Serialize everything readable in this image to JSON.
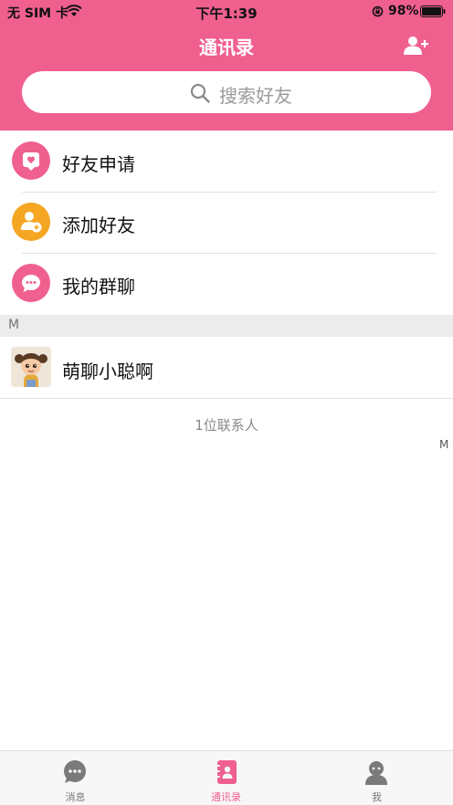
{
  "status_bar": {
    "carrier": "无 SIM 卡",
    "time": "下午1:39",
    "battery": "98%",
    "icons": [
      "wifi-icon",
      "orientation-lock-icon",
      "battery-icon"
    ]
  },
  "nav": {
    "title": "通讯录",
    "add_icon": "add-contact-icon"
  },
  "search": {
    "placeholder": "搜索好友",
    "icon": "search-icon"
  },
  "menu": [
    {
      "label": "好友申请",
      "icon": "heart-chat-icon",
      "color": "#f0608e"
    },
    {
      "label": "添加好友",
      "icon": "add-user-icon",
      "color": "#f5a623"
    },
    {
      "label": "我的群聊",
      "icon": "group-chat-icon",
      "color": "#f0608e"
    }
  ],
  "section": {
    "letter": "M"
  },
  "contacts": [
    {
      "name": "萌聊小聪啊",
      "avatar": "cartoon-girl-avatar"
    }
  ],
  "contact_count": "1位联系人",
  "index_bar": [
    "M"
  ],
  "tabs": [
    {
      "label": "消息",
      "icon": "message-icon",
      "active": false
    },
    {
      "label": "通讯录",
      "icon": "contacts-book-icon",
      "active": true
    },
    {
      "label": "我",
      "icon": "profile-icon",
      "active": false
    }
  ],
  "colors": {
    "brand": "#f0608e",
    "accent_orange": "#f5a623",
    "inactive_tab": "#777777"
  }
}
